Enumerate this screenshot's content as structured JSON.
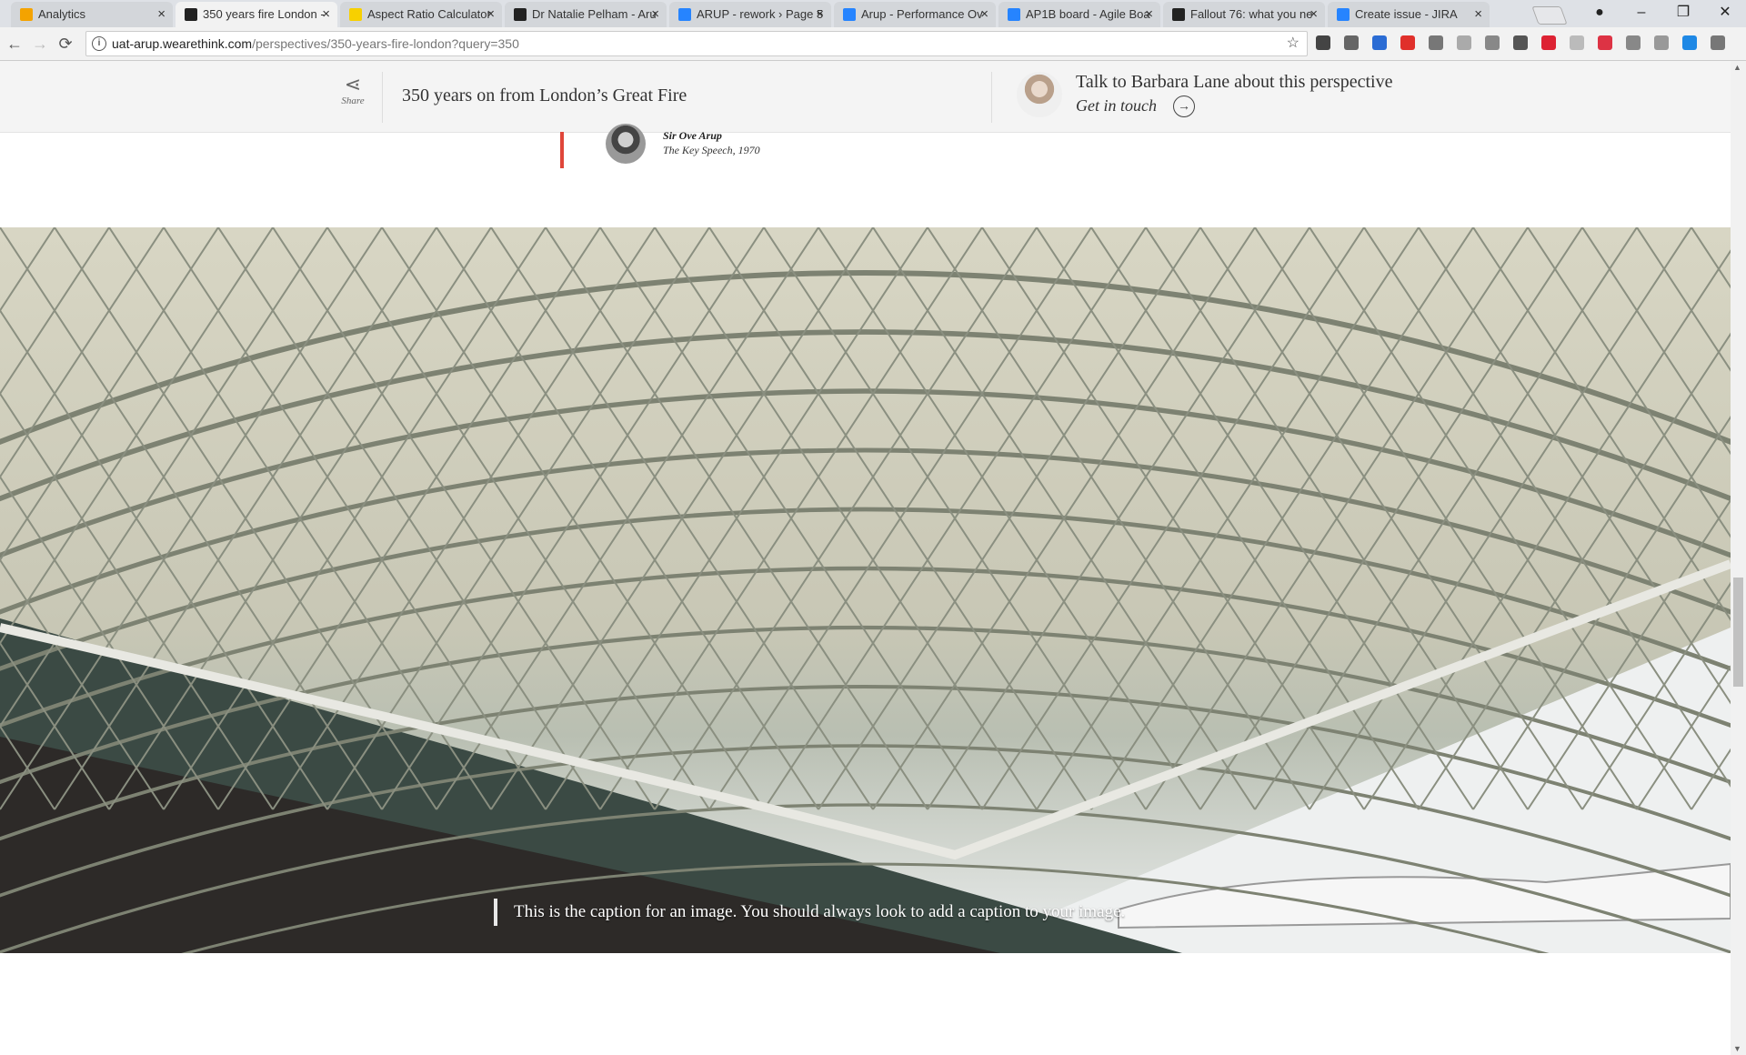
{
  "browser": {
    "tabs": [
      {
        "label": "Analytics",
        "favicon_color": "#f4a300"
      },
      {
        "label": "350 years fire London -",
        "favicon_color": "#222222",
        "active": true
      },
      {
        "label": "Aspect Ratio Calculator",
        "favicon_color": "#f7d000"
      },
      {
        "label": "Dr Natalie Pelham - Aru",
        "favicon_color": "#222222"
      },
      {
        "label": "ARUP - rework › Page 5",
        "favicon_color": "#2684ff"
      },
      {
        "label": "Arup - Performance Ov",
        "favicon_color": "#2684ff"
      },
      {
        "label": "AP1B board - Agile Boa",
        "favicon_color": "#2684ff"
      },
      {
        "label": "Fallout 76: what you ne",
        "favicon_color": "#222222"
      },
      {
        "label": "Create issue - JIRA",
        "favicon_color": "#2684ff"
      }
    ],
    "url_host": "uat-arup.wearethink.com",
    "url_path": "/perspectives/350-years-fire-london?query=350"
  },
  "sticky_bar": {
    "share_label": "Share",
    "title": "350 years on from London’s Great Fire",
    "contact_text": "Talk to Barbara Lane about this perspective",
    "get_in_touch": "Get in touch"
  },
  "quote": {
    "author": "Sir Ove Arup",
    "source": "The Key Speech, 1970",
    "accent_color": "#e0463a"
  },
  "hero": {
    "caption": "This is the caption for an image. You should always look to add a caption to your image."
  }
}
